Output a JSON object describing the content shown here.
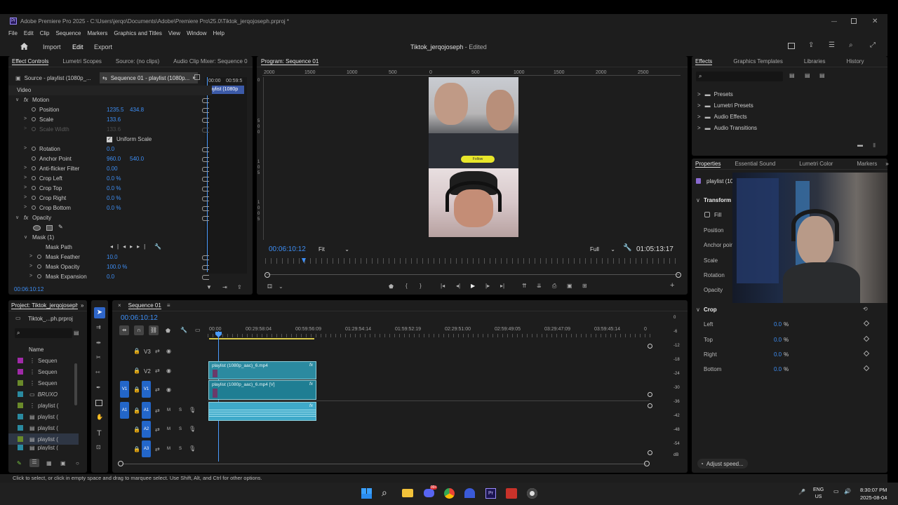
{
  "app": {
    "title": "Adobe Premiere Pro 2025 - C:\\Users\\jerqo\\Documents\\Adobe\\Premiere Pro\\25.0\\Tiktok_jerqojoseph.prproj *",
    "logo": "Pr",
    "project_name": "Tiktok_jerqojoseph",
    "edit_state": "- Edited"
  },
  "menu": [
    "File",
    "Edit",
    "Clip",
    "Sequence",
    "Markers",
    "Graphics and Titles",
    "View",
    "Window",
    "Help"
  ],
  "workspace": {
    "home_icon": "home-icon",
    "tabs": [
      "Import",
      "Edit",
      "Export"
    ],
    "active": "Edit"
  },
  "effect_controls": {
    "tabs": [
      "Effect Controls",
      "Lumetri Scopes",
      "Source: (no clips)",
      "Audio Clip Mixer: Sequence 0"
    ],
    "source_label": "Source - playlist (1080p_...",
    "sequence_label": "Sequence 01 - playlist (1080p...",
    "mini_time_start": "00:00",
    "mini_time_end": "00:59:5",
    "mini_clip": "playlist (1080p",
    "video_header": "Video",
    "motion": "Motion",
    "position_label": "Position",
    "position_x": "1235.5",
    "position_y": "434.8",
    "scale_label": "Scale",
    "scale_val": "133.6",
    "scale_width_label": "Scale Width",
    "scale_width_val": "133.6",
    "uniform_label": "Uniform Scale",
    "rotation_label": "Rotation",
    "rotation_val": "0.0",
    "anchor_label": "Anchor Point",
    "anchor_x": "960.0",
    "anchor_y": "540.0",
    "flicker_label": "Anti-flicker Filter",
    "flicker_val": "0.00",
    "crop_left_label": "Crop Left",
    "crop_left_val": "0.0 %",
    "crop_top_label": "Crop Top",
    "crop_top_val": "0.0 %",
    "crop_right_label": "Crop Right",
    "crop_right_val": "0.0 %",
    "crop_bottom_label": "Crop Bottom",
    "crop_bottom_val": "0.0 %",
    "opacity": "Opacity",
    "mask": "Mask (1)",
    "mask_path": "Mask Path",
    "mask_feather_label": "Mask Feather",
    "mask_feather_val": "10.0",
    "mask_opacity_label": "Mask Opacity",
    "mask_opacity_val": "100.0 %",
    "mask_expansion_label": "Mask Expansion",
    "mask_expansion_val": "0.0",
    "timecode": "00:06:10:12"
  },
  "program": {
    "tab": "Program: Sequence 01",
    "ruler": [
      "2000",
      "1500",
      "1000",
      "500",
      "0",
      "500",
      "1000",
      "1500",
      "2000",
      "2500"
    ],
    "vruler": [
      "0",
      "5",
      "0",
      "0",
      "1",
      "0",
      "5",
      "1",
      "0",
      "0",
      "5"
    ],
    "timecode": "00:06:10:12",
    "fit": "Fit",
    "full": "Full",
    "duration": "01:05:13:17",
    "sticker_text": "Follow"
  },
  "effects": {
    "tabs": [
      "Effects",
      "Graphics Templates",
      "Libraries",
      "History"
    ],
    "search_placeholder": "",
    "items": [
      "Presets",
      "Lumetri Presets",
      "Audio Effects",
      "Audio Transitions"
    ]
  },
  "properties": {
    "tabs": [
      "Properties",
      "Essential Sound",
      "Lumetri Color",
      "Markers"
    ],
    "clip_name": "playlist (10",
    "transform": "Transform",
    "fill": "Fill",
    "rows": [
      "Position",
      "Anchor poin",
      "Scale",
      "Rotation",
      "Opacity"
    ],
    "crop": "Crop",
    "crop_rows": [
      {
        "label": "Left",
        "value": "0.0",
        "unit": "%"
      },
      {
        "label": "Top",
        "value": "0.0",
        "unit": "%"
      },
      {
        "label": "Right",
        "value": "0.0",
        "unit": "%"
      },
      {
        "label": "Bottom",
        "value": "0.0",
        "unit": "%"
      }
    ],
    "adjust_speed": "Adjust speed..."
  },
  "project": {
    "tab": "Project: Tiktok_jerqojoseph",
    "file": "Tiktok_...ph.prproj",
    "name_header": "Name",
    "items": [
      {
        "name": "Sequen",
        "color": "#a02aa8"
      },
      {
        "name": "Sequen",
        "color": "#a02aa8"
      },
      {
        "name": "Sequen",
        "color": "#6a8a2a"
      },
      {
        "name": "BRUXO",
        "color": "#2a8aa0"
      },
      {
        "name": "playlist (",
        "color": "#6a8a2a"
      },
      {
        "name": "playlist (",
        "color": "#2a8aa0"
      },
      {
        "name": "playlist (",
        "color": "#2a8aa0"
      },
      {
        "name": "playlist (",
        "color": "#6a8a2a"
      },
      {
        "name": "playlist (",
        "color": "#2a8aa0"
      }
    ]
  },
  "timeline": {
    "tab": "Sequence 01",
    "timecode": "00:06:10:12",
    "ruler": [
      "00:00",
      "00:29:58:04",
      "00:59:56:09",
      "01:29:54:14",
      "01:59:52:19",
      "02:29:51:00",
      "02:59:49:05",
      "03:29:47:09",
      "03:59:45:14",
      "0"
    ],
    "tracks": [
      "V3",
      "V2",
      "V1",
      "A1",
      "A2",
      "A3"
    ],
    "source_v1": "V1",
    "source_a1": "A1",
    "clip_v2": "playlist (1080p_aac)_6.mp4",
    "clip_v1": "playlist (1080p_aac)_6.mp4 [V]",
    "fx": "fx",
    "meter": [
      "0",
      "-6",
      "-12",
      "-18",
      "-24",
      "-30",
      "-36",
      "-42",
      "-48",
      "-54",
      "dB"
    ],
    "ms": [
      "M",
      "S"
    ]
  },
  "status": "Click to select, or click in empty space and drag to marquee select. Use Shift, Alt, and Ctrl for other options.",
  "taskbar": {
    "lang": "ENG",
    "region": "US",
    "time": "8:30:07 PM",
    "date": "2025-08-04",
    "badge": "99+"
  }
}
